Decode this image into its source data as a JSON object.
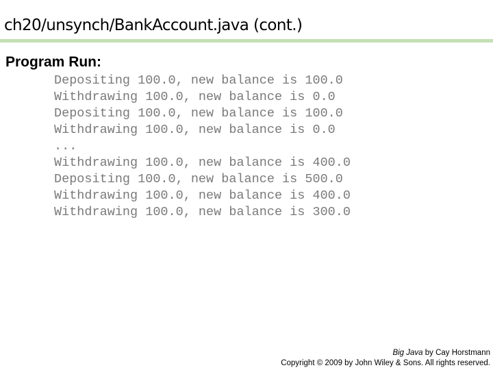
{
  "slide": {
    "title": "ch20/unsynch/BankAccount.java (cont.)",
    "subheading": "Program Run:",
    "output_lines": [
      "Depositing 100.0, new balance is 100.0",
      "Withdrawing 100.0, new balance is 0.0",
      "Depositing 100.0, new balance is 100.0",
      "Withdrawing 100.0, new balance is 0.0",
      "...",
      "Withdrawing 100.0, new balance is 400.0",
      "Depositing 100.0, new balance is 500.0",
      "Withdrawing 100.0, new balance is 400.0",
      "Withdrawing 100.0, new balance is 300.0"
    ],
    "accent_color": "#c3e0b4"
  },
  "footer": {
    "book_title": "Big Java",
    "author_text": " by Cay Horstmann",
    "copyright": "Copyright © 2009 by John Wiley & Sons.  All rights reserved."
  }
}
